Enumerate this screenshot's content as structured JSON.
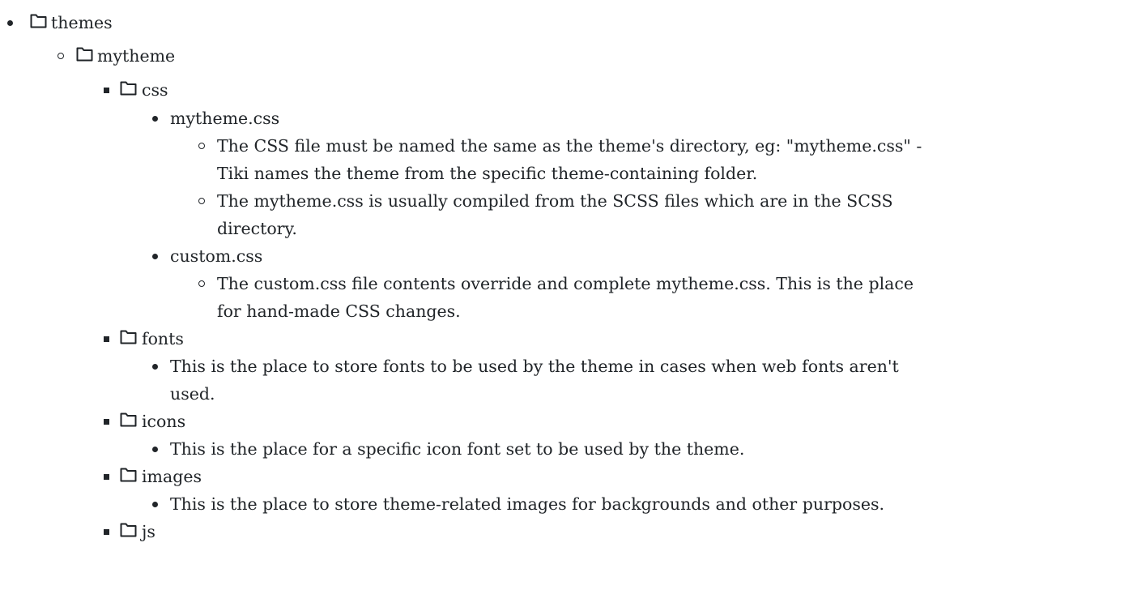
{
  "tree": {
    "themes": "themes",
    "mytheme": "mytheme",
    "css": "css",
    "mytheme_css": "mytheme.css",
    "mytheme_css_note1_line1": "The CSS file must be named the same as the theme's directory, eg: \"mytheme.css\" -",
    "mytheme_css_note1_line2": "Tiki names the theme from the specific theme-containing folder.",
    "mytheme_css_note2_line1": "The mytheme.css is usually compiled from the SCSS files which are in the SCSS",
    "mytheme_css_note2_line2": "directory.",
    "custom_css": "custom.css",
    "custom_css_note_line1": "The custom.css file contents override and complete mytheme.css. This is the place",
    "custom_css_note_line2": "for hand-made CSS changes.",
    "fonts": "fonts",
    "fonts_note_line1": "This is the place to store fonts to be used by the theme in cases when web fonts aren't",
    "fonts_note_line2": "used.",
    "icons": "icons",
    "icons_note": "This is the place for a specific icon font set to be used by the theme.",
    "images": "images",
    "images_note": "This is the place to store theme-related images for backgrounds and other purposes.",
    "js": "js"
  },
  "icons": {
    "folder": "folder-icon"
  },
  "colors": {
    "text": "#212529"
  }
}
